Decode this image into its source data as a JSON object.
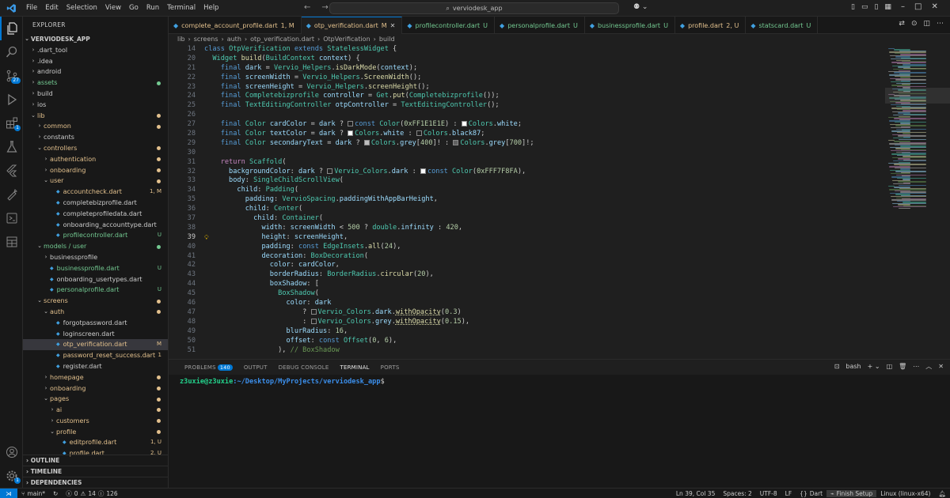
{
  "menus": [
    "File",
    "Edit",
    "Selection",
    "View",
    "Go",
    "Run",
    "Terminal",
    "Help"
  ],
  "search": {
    "label": "verviodesk_app"
  },
  "explorer": {
    "title": "EXPLORER",
    "root": "VERVIODESK_APP",
    "items": [
      {
        "label": ".dart_tool",
        "indent": 1,
        "chev": "›",
        "color": "#cccccc"
      },
      {
        "label": ".idea",
        "indent": 1,
        "chev": "›",
        "color": "#cccccc"
      },
      {
        "label": "android",
        "indent": 1,
        "chev": "›",
        "color": "#cccccc"
      },
      {
        "label": "assets",
        "indent": 1,
        "chev": "›",
        "color": "#73c991",
        "dot": "#73c991"
      },
      {
        "label": "build",
        "indent": 1,
        "chev": "›",
        "color": "#cccccc"
      },
      {
        "label": "ios",
        "indent": 1,
        "chev": "›",
        "color": "#cccccc"
      },
      {
        "label": "lib",
        "indent": 1,
        "chev": "⌄",
        "color": "#e2c08d",
        "dot": "#e2c08d"
      },
      {
        "label": "common",
        "indent": 2,
        "chev": "›",
        "color": "#e2c08d",
        "dot": "#e2c08d"
      },
      {
        "label": "constants",
        "indent": 2,
        "chev": "›",
        "color": "#cccccc"
      },
      {
        "label": "controllers",
        "indent": 2,
        "chev": "⌄",
        "color": "#e2c08d",
        "dot": "#e2c08d"
      },
      {
        "label": "authentication",
        "indent": 3,
        "chev": "›",
        "color": "#e2c08d",
        "dot": "#e2c08d"
      },
      {
        "label": "onboarding",
        "indent": 3,
        "chev": "›",
        "color": "#e2c08d",
        "dot": "#e2c08d"
      },
      {
        "label": "user",
        "indent": 3,
        "chev": "⌄",
        "color": "#e2c08d",
        "dot": "#e2c08d"
      },
      {
        "label": "accountcheck.dart",
        "indent": 4,
        "chev": "",
        "color": "#e2c08d",
        "status": "1, M",
        "scolor": "#e2c08d",
        "file": true
      },
      {
        "label": "completebizprofile.dart",
        "indent": 4,
        "chev": "",
        "color": "#cccccc",
        "file": true
      },
      {
        "label": "completeprofiledata.dart",
        "indent": 4,
        "chev": "",
        "color": "#cccccc",
        "file": true
      },
      {
        "label": "onboarding_accounttype.dart",
        "indent": 4,
        "chev": "",
        "color": "#cccccc",
        "file": true
      },
      {
        "label": "profilecontroller.dart",
        "indent": 4,
        "chev": "",
        "color": "#73c991",
        "status": "U",
        "scolor": "#73c991",
        "file": true
      },
      {
        "label": "models / user",
        "indent": 2,
        "chev": "⌄",
        "color": "#73c991",
        "dot": "#73c991"
      },
      {
        "label": "businessprofile",
        "indent": 3,
        "chev": "›",
        "color": "#cccccc"
      },
      {
        "label": "businessprofile.dart",
        "indent": 3,
        "chev": "",
        "color": "#73c991",
        "status": "U",
        "scolor": "#73c991",
        "file": true
      },
      {
        "label": "onboarding_usertypes.dart",
        "indent": 3,
        "chev": "",
        "color": "#cccccc",
        "file": true
      },
      {
        "label": "personalprofile.dart",
        "indent": 3,
        "chev": "",
        "color": "#73c991",
        "status": "U",
        "scolor": "#73c991",
        "file": true
      },
      {
        "label": "screens",
        "indent": 2,
        "chev": "⌄",
        "color": "#e2c08d",
        "dot": "#e2c08d"
      },
      {
        "label": "auth",
        "indent": 3,
        "chev": "⌄",
        "color": "#e2c08d",
        "dot": "#e2c08d"
      },
      {
        "label": "forgotpassword.dart",
        "indent": 4,
        "chev": "",
        "color": "#cccccc",
        "file": true
      },
      {
        "label": "loginscreen.dart",
        "indent": 4,
        "chev": "",
        "color": "#cccccc",
        "file": true
      },
      {
        "label": "otp_verification.dart",
        "indent": 4,
        "chev": "",
        "color": "#e2c08d",
        "status": "M",
        "scolor": "#e2c08d",
        "file": true,
        "selected": true
      },
      {
        "label": "password_reset_success.dart",
        "indent": 4,
        "chev": "",
        "color": "#e2c08d",
        "status": "1",
        "scolor": "#e2c08d",
        "file": true
      },
      {
        "label": "register.dart",
        "indent": 4,
        "chev": "",
        "color": "#cccccc",
        "file": true
      },
      {
        "label": "homepage",
        "indent": 3,
        "chev": "›",
        "color": "#e2c08d",
        "dot": "#e2c08d"
      },
      {
        "label": "onboarding",
        "indent": 3,
        "chev": "›",
        "color": "#e2c08d",
        "dot": "#e2c08d"
      },
      {
        "label": "pages",
        "indent": 3,
        "chev": "⌄",
        "color": "#e2c08d",
        "dot": "#e2c08d"
      },
      {
        "label": "ai",
        "indent": 4,
        "chev": "›",
        "color": "#e2c08d",
        "dot": "#e2c08d"
      },
      {
        "label": "customers",
        "indent": 4,
        "chev": "›",
        "color": "#e2c08d",
        "dot": "#e2c08d"
      },
      {
        "label": "profile",
        "indent": 4,
        "chev": "⌄",
        "color": "#e2c08d",
        "dot": "#e2c08d"
      },
      {
        "label": "editprofile.dart",
        "indent": 5,
        "chev": "",
        "color": "#e2c08d",
        "status": "1, U",
        "scolor": "#e2c08d",
        "file": true
      },
      {
        "label": "profile.dart",
        "indent": 5,
        "chev": "",
        "color": "#e2c08d",
        "status": "2, U",
        "scolor": "#e2c08d",
        "file": true
      }
    ],
    "sections": [
      "OUTLINE",
      "TIMELINE",
      "DEPENDENCIES"
    ]
  },
  "tabs": [
    {
      "label": "complete_account_profile.dart",
      "status": "1, M",
      "scolor": "#e2c08d"
    },
    {
      "label": "otp_verification.dart",
      "status": "M",
      "scolor": "#e2c08d",
      "active": true
    },
    {
      "label": "profilecontroller.dart",
      "status": "U",
      "scolor": "#73c991"
    },
    {
      "label": "personalprofile.dart",
      "status": "U",
      "scolor": "#73c991"
    },
    {
      "label": "businessprofile.dart",
      "status": "U",
      "scolor": "#73c991"
    },
    {
      "label": "profile.dart",
      "status": "2, U",
      "scolor": "#e2c08d"
    },
    {
      "label": "statscard.dart",
      "status": "U",
      "scolor": "#73c991"
    }
  ],
  "breadcrumb": [
    "lib",
    "screens",
    "auth",
    "otp_verification.dart",
    "OtpVerification",
    "build"
  ],
  "code": [
    {
      "ln": "14",
      "sticky": true,
      "html": "<span class='k'>class</span> <span class='t'>OtpVerification</span> <span class='k'>extends</span> <span class='t'>StatelessWidget</span> {"
    },
    {
      "ln": "20",
      "sticky": true,
      "html": "  <span class='t'>Widget</span> <span class='f'>build</span>(<span class='t'>BuildContext</span> <span class='v'>context</span>) {"
    },
    {
      "ln": "21",
      "html": "    <span class='k'>final</span> <span class='v'>dark</span> = <span class='t'>Vervio_Helpers</span>.<span class='f'>isDarkMode</span>(<span class='v'>context</span>);"
    },
    {
      "ln": "22",
      "html": "    <span class='k'>final</span> <span class='v'>screenWidth</span> = <span class='t'>Vervio_Helpers</span>.<span class='f'>ScreenWidth</span>();"
    },
    {
      "ln": "23",
      "html": "    <span class='k'>final</span> <span class='v'>screenHeight</span> = <span class='t'>Vervio_Helpers</span>.<span class='f'>screenHeight</span>();"
    },
    {
      "ln": "24",
      "html": "    <span class='k'>final</span> <span class='t'>Completebizprofile</span> <span class='v'>controller</span> = <span class='t'>Get</span>.<span class='f'>put</span>(<span class='t'>Completebizprofile</span>());"
    },
    {
      "ln": "25",
      "html": "    <span class='k'>final</span> <span class='t'>TextEditingController</span> <span class='v'>otpController</span> = <span class='t'>TextEditingController</span>();"
    },
    {
      "ln": "26",
      "html": ""
    },
    {
      "ln": "27",
      "html": "    <span class='k'>final</span> <span class='t'>Color</span> <span class='v'>cardColor</span> = <span class='v'>dark</span> ? <span class='sw' style='background:#1E1E1E'></span><span class='k'>const</span> <span class='t'>Color</span>(<span class='n'>0xFF1E1E1E</span>) : <span class='sw' style='background:#ffffff'></span><span class='t'>Colors</span>.<span class='v'>white</span>;"
    },
    {
      "ln": "28",
      "html": "    <span class='k'>final</span> <span class='t'>Color</span> <span class='v'>textColor</span> = <span class='v'>dark</span> ? <span class='sw' style='background:#ffffff'></span><span class='t'>Colors</span>.<span class='v'>white</span> : <span class='sw' style='background:#1f1f1f'></span><span class='t'>Colors</span>.<span class='v'>black87</span>;"
    },
    {
      "ln": "29",
      "html": "    <span class='k'>final</span> <span class='t'>Color</span> <span class='v'>secondaryText</span> = <span class='v'>dark</span> ? <span class='sw' style='background:#bdbdbd'></span><span class='t'>Colors</span>.<span class='v'>grey</span>[<span class='n'>400</span>]! : <span class='sw' style='background:#616161'></span><span class='t'>Colors</span>.<span class='v'>grey</span>[<span class='n'>700</span>]!;"
    },
    {
      "ln": "30",
      "html": ""
    },
    {
      "ln": "31",
      "html": "    <span class='kc'>return</span> <span class='t'>Scaffold</span>("
    },
    {
      "ln": "32",
      "html": "      <span class='v'>backgroundColor</span>: <span class='v'>dark</span> ? <span class='sw' style='background:#1f1f1f'></span><span class='t'>Vervio_Colors</span>.<span class='v'>dark</span> : <span class='sw' style='background:#F7F8FA'></span><span class='k'>const</span> <span class='t'>Color</span>(<span class='n'>0xFFF7F8FA</span>),"
    },
    {
      "ln": "33",
      "html": "      <span class='v'>body</span>: <span class='t'>SingleChildScrollView</span>("
    },
    {
      "ln": "34",
      "html": "        <span class='v'>child</span>: <span class='t'>Padding</span>("
    },
    {
      "ln": "35",
      "html": "          <span class='v'>padding</span>: <span class='t'>VervioSpacing</span>.<span class='v'>paddingWithAppBarHeight</span>,"
    },
    {
      "ln": "36",
      "html": "          <span class='v'>child</span>: <span class='t'>Center</span>("
    },
    {
      "ln": "37",
      "html": "            <span class='v'>child</span>: <span class='t'>Container</span>("
    },
    {
      "ln": "38",
      "html": "              <span class='v'>width</span>: <span class='v'>screenWidth</span> &lt; <span class='n'>500</span> ? <span class='t'>double</span>.<span class='v'>infinity</span> : <span class='n'>420</span>,"
    },
    {
      "ln": "39",
      "html": "              <span class='v'>height</span>: <span class='v'>screenHeight</span>,",
      "current": true
    },
    {
      "ln": "40",
      "html": "              <span class='v'>padding</span>: <span class='k'>const</span> <span class='t'>EdgeInsets</span>.<span class='f'>all</span>(<span class='n'>24</span>),"
    },
    {
      "ln": "41",
      "html": "              <span class='v'>decoration</span>: <span class='t'>BoxDecoration</span>("
    },
    {
      "ln": "42",
      "html": "                <span class='v'>color</span>: <span class='v'>cardColor</span>,"
    },
    {
      "ln": "43",
      "html": "                <span class='v'>borderRadius</span>: <span class='t'>BorderRadius</span>.<span class='f'>circular</span>(<span class='n'>20</span>),"
    },
    {
      "ln": "44",
      "html": "                <span class='v'>boxShadow</span>: ["
    },
    {
      "ln": "45",
      "html": "                  <span class='t'>BoxShadow</span>("
    },
    {
      "ln": "46",
      "html": "                    <span class='v'>color</span>: <span class='v'>dark</span>"
    },
    {
      "ln": "47",
      "html": "                        ? <span class='sw' style='background:#1f1f1f'></span><span class='t'>Vervio_Colors</span>.<span class='v'>dark</span>.<span class='f' style='text-decoration:underline dotted'>withOpacity</span>(<span class='n'>0.3</span>)"
    },
    {
      "ln": "48",
      "html": "                        : <span class='sw' style='background:#1f1f1f'></span><span class='t'>Vervio_Colors</span>.<span class='v'>grey</span>.<span class='f' style='text-decoration:underline dotted'>withOpacity</span>(<span class='n'>0.15</span>),"
    },
    {
      "ln": "49",
      "html": "                    <span class='v'>blurRadius</span>: <span class='n'>16</span>,"
    },
    {
      "ln": "50",
      "html": "                    <span class='v'>offset</span>: <span class='k'>const</span> <span class='t'>Offset</span>(<span class='n'>0</span>, <span class='n'>6</span>),"
    },
    {
      "ln": "51",
      "html": "                  ), <span class='c'>// BoxShadow</span>"
    }
  ],
  "panel": {
    "tabs": [
      "PROBLEMS",
      "OUTPUT",
      "DEBUG CONSOLE",
      "TERMINAL",
      "PORTS"
    ],
    "problems_count": "140",
    "active": "TERMINAL",
    "shell": "bash",
    "prompt_user": "z3uxie@z3uxie",
    "prompt_path": ":~/Desktop/MyProjects/verviodesk_app",
    "prompt_symbol": "$"
  },
  "statusbar": {
    "branch": "main*",
    "errors": "0",
    "warnings": "14",
    "info": "126",
    "position": "Ln 39, Col 35",
    "spaces": "Spaces: 2",
    "encoding": "UTF-8",
    "eol": "LF",
    "language": "Dart",
    "setup": "Finish Setup",
    "platform": "Linux (linux-x64)"
  },
  "colors": {
    "accent": "#0078d4",
    "modified": "#e2c08d",
    "untracked": "#73c991"
  }
}
